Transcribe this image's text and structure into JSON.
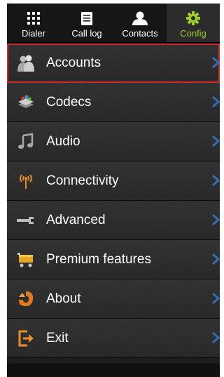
{
  "tabs": [
    {
      "label": "Dialer",
      "icon": "dialpad-icon",
      "active": false
    },
    {
      "label": "Call log",
      "icon": "call-log-icon",
      "active": false
    },
    {
      "label": "Contacts",
      "icon": "contacts-icon",
      "active": false
    },
    {
      "label": "Config",
      "icon": "gear-icon",
      "active": true
    }
  ],
  "menu": [
    {
      "label": "Accounts",
      "icon": "accounts-icon",
      "selected": true
    },
    {
      "label": "Codecs",
      "icon": "codecs-icon"
    },
    {
      "label": "Audio",
      "icon": "music-note-icon"
    },
    {
      "label": "Connectivity",
      "icon": "antenna-icon"
    },
    {
      "label": "Advanced",
      "icon": "wrench-icon"
    },
    {
      "label": "Premium features",
      "icon": "cart-icon"
    },
    {
      "label": "About",
      "icon": "about-icon"
    },
    {
      "label": "Exit",
      "icon": "exit-icon"
    }
  ],
  "colors": {
    "active_tab": "#9ccd2a",
    "selection_border": "#d22a2a",
    "chevron": "#2f6fb5"
  }
}
